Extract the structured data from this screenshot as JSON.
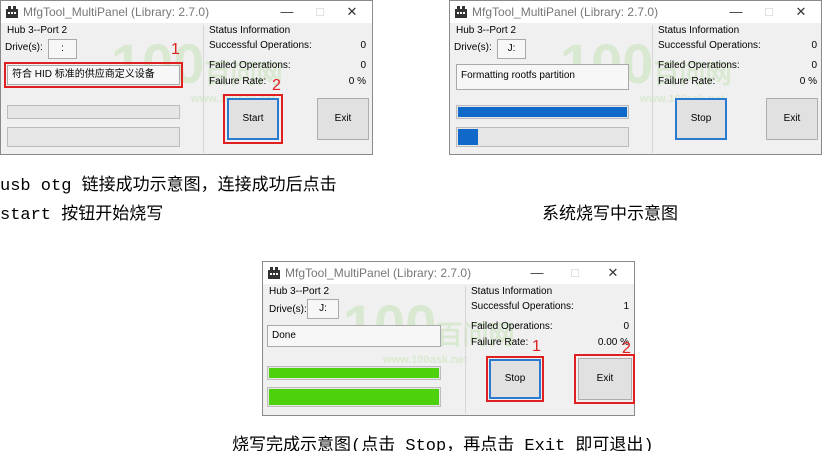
{
  "colors": {
    "progress_blue": "#1068c8",
    "progress_green": "#4cd10c",
    "annotation_red": "#e02020",
    "focus_blue": "#2a7bd0"
  },
  "window_title": "MfgTool_MultiPanel (Library: 2.7.0)",
  "window_controls": {
    "minimize": "—",
    "maximize": "□",
    "close": "✕"
  },
  "panels": [
    {
      "hub": "Hub 3--Port 2",
      "drive_label": "Drive(s):",
      "drive_value": ":",
      "status_text": "符合 HID 标准的供应商定义设备",
      "status_info_title": "Status Information",
      "successful_label": "Successful Operations:",
      "successful_value": "0",
      "failed_label": "Failed Operations:",
      "failed_value": "0",
      "failure_rate_label": "Failure Rate:",
      "failure_rate_value": "0 %",
      "start_stop_label": "Start",
      "exit_label": "Exit",
      "progress1": 0,
      "progress2": 0,
      "marker_1": "1",
      "marker_2": "2"
    },
    {
      "hub": "Hub 3--Port 2",
      "drive_label": "Drive(s):",
      "drive_value": "J:",
      "status_text": "Formatting rootfs partition",
      "status_info_title": "Status Information",
      "successful_label": "Successful Operations:",
      "successful_value": "0",
      "failed_label": "Failed Operations:",
      "failed_value": "0",
      "failure_rate_label": "Failure Rate:",
      "failure_rate_value": "0 %",
      "start_stop_label": "Stop",
      "exit_label": "Exit",
      "progress1": 1.0,
      "progress2": 0.12
    },
    {
      "hub": "Hub 3--Port 2",
      "drive_label": "Drive(s):",
      "drive_value": "J:",
      "status_text": "Done",
      "status_info_title": "Status Information",
      "successful_label": "Successful Operations:",
      "successful_value": "1",
      "failed_label": "Failed Operations:",
      "failed_value": "0",
      "failure_rate_label": "Failure Rate:",
      "failure_rate_value": "0.00 %",
      "start_stop_label": "Stop",
      "exit_label": "Exit",
      "progress1": 1.0,
      "progress2": 1.0,
      "marker_1": "1",
      "marker_2": "2"
    }
  ],
  "captions": {
    "panel1_line1": "usb  otg 链接成功示意图，连接成功后点击",
    "panel1_line2": "start 按钮开始烧写",
    "panel2": "系统烧写中示意图",
    "panel3": "烧写完成示意图(点击 Stop，再点击 Exit 即可退出)"
  },
  "watermark": {
    "big": "100",
    "cn": "百问网",
    "url": "www.100ask.net"
  }
}
